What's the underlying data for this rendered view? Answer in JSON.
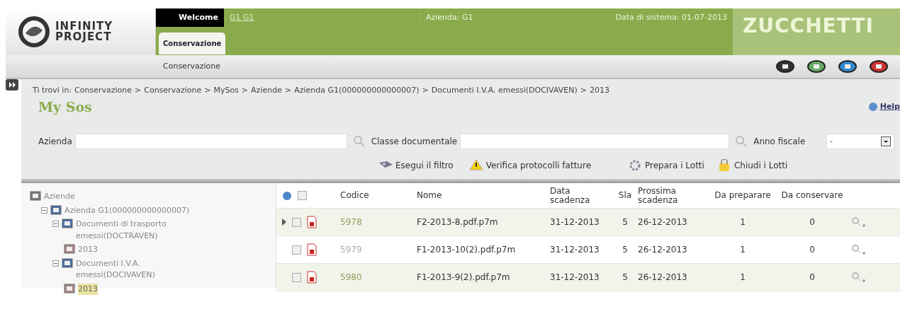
{
  "header": {
    "logo": [
      "INFINITY",
      "PROJECT"
    ],
    "welcome_label": "Welcome",
    "user": "G1 G1",
    "company": "Azienda: G1",
    "system_date": "Data di sistema: 01-07-2013",
    "brand": "ZUCCHETTI"
  },
  "tabs": [
    {
      "label": "Conservazione",
      "selected": true
    }
  ],
  "subtabs": [
    {
      "label": "Conservazione",
      "selected": false
    }
  ],
  "breadcrumb": {
    "prefix": "Ti trovi in:",
    "separator": ">",
    "items": [
      "Conservazione",
      "Conservazione",
      "MySos",
      "Aziende",
      "Azienda G1(000000000000007)",
      "Documenti I.V.A. emessi(DOCIVAVEN)"
    ],
    "current": "2013"
  },
  "title": "My Sos",
  "help": "Help",
  "filters": [
    {
      "label": "Azienda",
      "kind": "lookup"
    },
    {
      "label": "Classe documentale",
      "kind": "lookup"
    },
    {
      "label": "Anno fiscale",
      "kind": "select",
      "value": "-"
    }
  ],
  "actions": [
    {
      "label": "Esegui il filtro",
      "kind": "filter"
    },
    {
      "label": "Verifica protocolli fatture",
      "kind": "warning"
    },
    {
      "label": "Prepara i Lotti",
      "kind": "gear"
    },
    {
      "label": "Chiudi i Lotti",
      "kind": "lock"
    }
  ],
  "tree": {
    "label": "Aziende",
    "children": [
      {
        "label": "Azienda G1(000000000000007)",
        "expanded": true,
        "children": [
          {
            "label": "Documenti di trasporto emessi(DOCTRAVEN)",
            "expanded": true,
            "children": [
              {
                "label": "2013",
                "selected": false
              }
            ]
          },
          {
            "label": "Documenti I.V.A. emessi(DOCIVAVEN)",
            "expanded": true,
            "children": [
              {
                "label": "2013",
                "selected": true
              }
            ]
          }
        ]
      }
    ]
  },
  "table": {
    "all_checked": false,
    "columns": [
      "Codice",
      "Nome",
      "Data scadenza",
      "Sla",
      "Prossima scadenza",
      "Da preparare",
      "Da conservare"
    ],
    "rows": [
      {
        "current": true,
        "checked": false,
        "cells": [
          "5978",
          "F2-2013-8.pdf.p7m",
          "31-12-2013",
          "5",
          "26-12-2013",
          "1",
          "0"
        ]
      },
      {
        "current": false,
        "checked": false,
        "cells": [
          "5979",
          "F1-2013-10(2).pdf.p7m",
          "31-12-2013",
          "5",
          "26-12-2013",
          "1",
          "0"
        ]
      },
      {
        "current": false,
        "checked": false,
        "cells": [
          "5980",
          "F1-2013-9(2).pdf.p7m",
          "31-12-2013",
          "5",
          "26-12-2013",
          "1",
          "0"
        ]
      }
    ]
  }
}
